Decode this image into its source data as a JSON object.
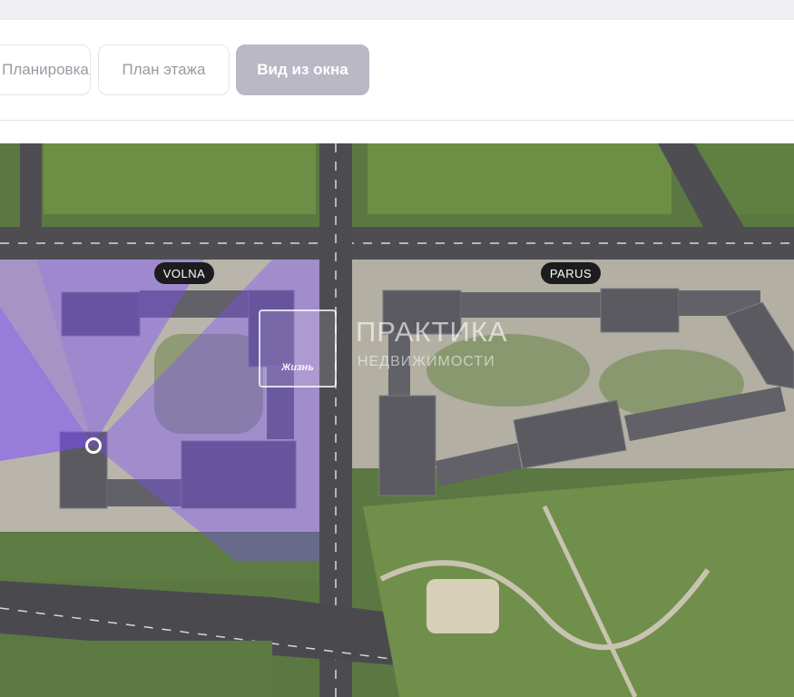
{
  "tabs": {
    "layout_label": "Планировка",
    "floor_plan_label": "План этажа",
    "window_view_label": "Вид из окна"
  },
  "map": {
    "buildings": {
      "volna": "VOLNA",
      "parus": "PARUS"
    },
    "watermark": {
      "logo_text": "Жизнь",
      "title": "ПРАКТИКА",
      "subtitle": "НЕДВИЖИМОСТИ"
    }
  },
  "colors": {
    "active_tab_bg": "#b9b8c4",
    "view_cone": "#7b4dff",
    "label_bg": "#1c1c1f"
  }
}
